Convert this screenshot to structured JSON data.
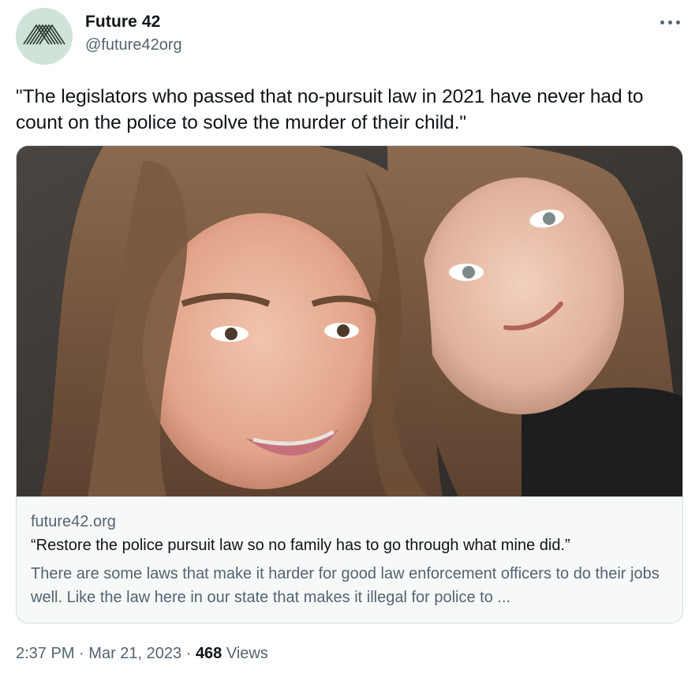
{
  "author": {
    "display_name": "Future 42",
    "handle": "@future42org",
    "avatar_icon": "future42-logo-icon",
    "avatar_bg": "#cfe3d6"
  },
  "more_icon": "more-options-icon",
  "tweet": {
    "text": "\"The legislators who passed that no-pursuit law in 2021 have never had to count on the police to solve the murder of their child.\""
  },
  "card": {
    "domain": "future42.org",
    "title": "“Restore the police pursuit law so no family has to go through what mine did.”",
    "description": "There are some laws that make it harder for good law enforcement officers to do their jobs well. Like the law here in our state that makes it illegal for police to ..."
  },
  "meta": {
    "time": "2:37 PM",
    "separator": "·",
    "date": "Mar 21, 2023",
    "views_count": "468",
    "views_label": "Views"
  },
  "colors": {
    "text_primary": "#0f1419",
    "text_secondary": "#536471",
    "border": "#cfd9de",
    "card_bg": "#f7f9f9"
  }
}
